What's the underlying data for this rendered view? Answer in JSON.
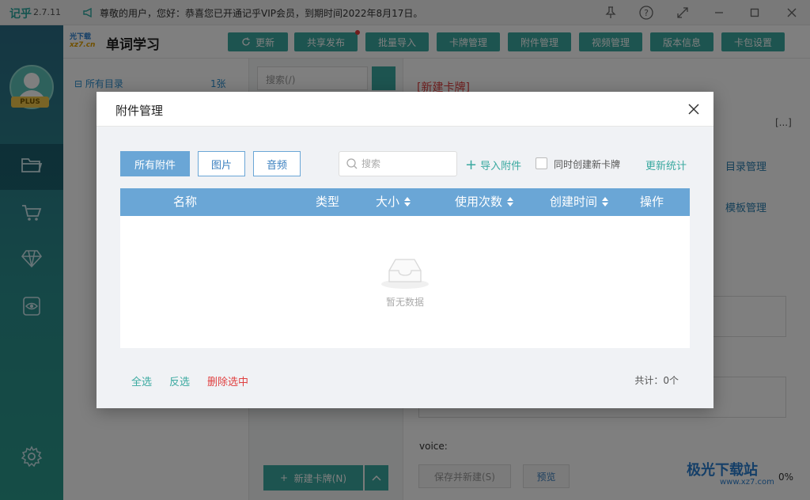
{
  "titlebar": {
    "app_logo": "记乎",
    "version": "2.7.11",
    "notice": "尊敬的用户，您好：恭喜您已开通记乎VIP会员，到期时间2022年8月17日。"
  },
  "sidebar": {
    "badge": "PLUS"
  },
  "toolbar": {
    "brand_line1": "光下载",
    "brand_line2": "xz7.cn",
    "deck_title": "单词学习",
    "buttons": [
      "更新",
      "共享发布",
      "批量导入",
      "卡牌管理",
      "附件管理",
      "视频管理",
      "版本信息",
      "卡包设置"
    ]
  },
  "tree": {
    "root_label": "所有目录",
    "root_count": "1张"
  },
  "list": {
    "search_placeholder": "搜索(/)",
    "new_card_label": "新建卡牌(N)"
  },
  "editor": {
    "title": "[新建卡牌]",
    "dir_manage": "目录管理",
    "template_manage": "模板管理",
    "voice_label": "voice:",
    "save_new": "保存并新建(S)",
    "preview": "预览",
    "percent": "0%",
    "more": "[...]"
  },
  "watermark": {
    "text": "极光下载站",
    "sub": "www.xz7.com"
  },
  "dialog": {
    "title": "附件管理",
    "filters": [
      "所有附件",
      "图片",
      "音频"
    ],
    "search_placeholder": "搜索",
    "import_label": "导入附件",
    "checkbox_label": "同时创建新卡牌",
    "refresh_label": "更新统计",
    "columns": [
      "名称",
      "类型",
      "大小",
      "使用次数",
      "创建时间",
      "操作"
    ],
    "empty_text": "暂无数据",
    "select_all": "全选",
    "invert_select": "反选",
    "delete_selected": "删除选中",
    "total": "共计：0个"
  },
  "colors": {
    "teal": "#3aa9a0",
    "table_header": "#6aa6d6",
    "danger": "#e04040"
  }
}
